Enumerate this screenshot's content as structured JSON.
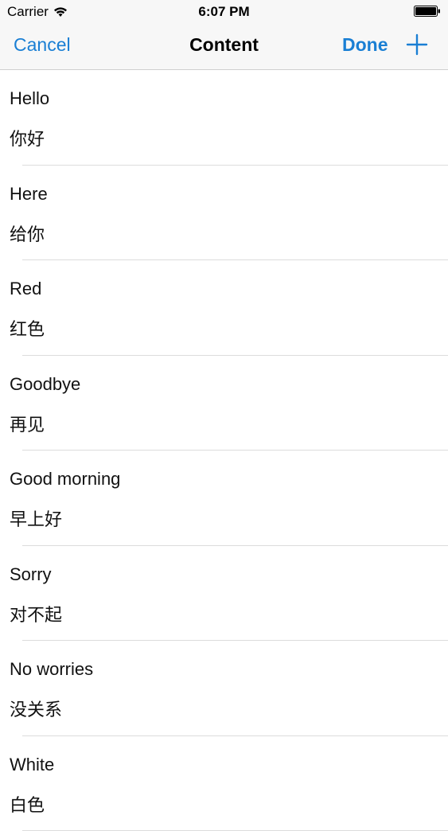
{
  "status_bar": {
    "carrier": "Carrier",
    "time": "6:07 PM"
  },
  "nav": {
    "cancel_label": "Cancel",
    "title": "Content",
    "done_label": "Done",
    "add_icon": "plus-icon",
    "accent_color": "#1a7fd4"
  },
  "items": [
    {
      "title": "Hello",
      "subtitle": "你好"
    },
    {
      "title": "Here",
      "subtitle": "给你"
    },
    {
      "title": "Red",
      "subtitle": "红色"
    },
    {
      "title": "Goodbye",
      "subtitle": "再见"
    },
    {
      "title": "Good morning",
      "subtitle": "早上好"
    },
    {
      "title": "Sorry",
      "subtitle": "对不起"
    },
    {
      "title": "No worries",
      "subtitle": "没关系"
    },
    {
      "title": "White",
      "subtitle": "白色"
    }
  ]
}
